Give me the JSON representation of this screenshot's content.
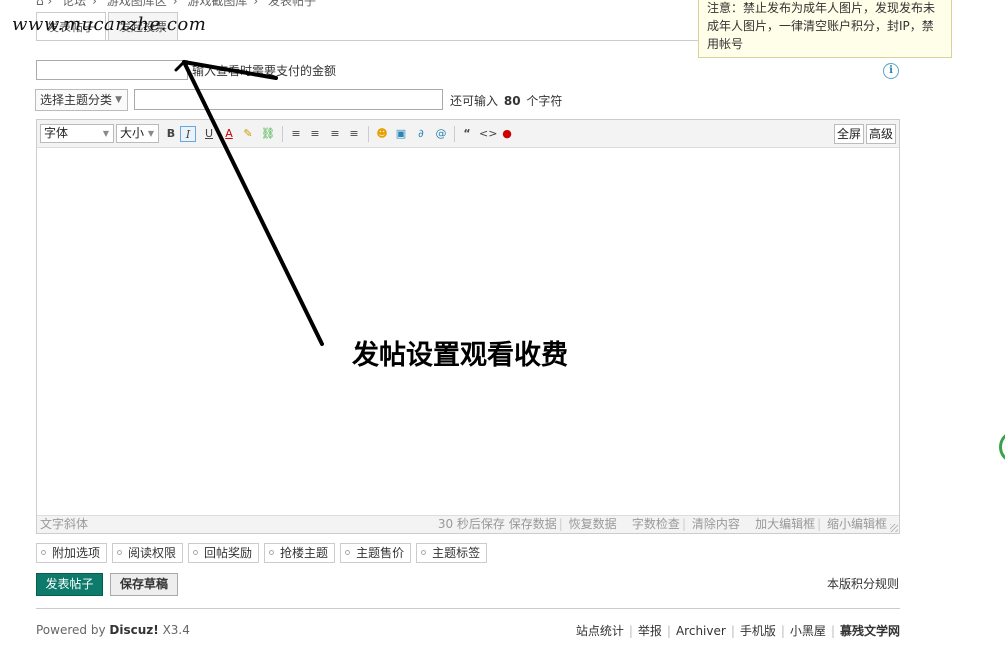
{
  "breadcrumb": [
    "论坛",
    "游戏图库区",
    "游戏截图库",
    "发表帖子"
  ],
  "tabs": [
    "发表帖子",
    "发起投票"
  ],
  "watermark": "www.mucanzhe.com",
  "notice": "注意：禁止发布为成年人图片，发现发布未成年人图片，一律清空账户积分，封IP，禁用帐号",
  "price_hint": "输入查看时需要支付的金额",
  "type_select": "选择主题分类",
  "subject_remaining": {
    "prefix": "还可输入",
    "count": "80",
    "suffix": "个字符"
  },
  "toolbar": {
    "font": "字体",
    "size": "大小",
    "fullscreen": "全屏",
    "advanced": "高级"
  },
  "status": {
    "left": "文字斜体",
    "autosave": "30 秒后保存",
    "save_data": "保存数据",
    "restore_data": "恢复数据",
    "word_check": "字数检查",
    "clear": "清除内容",
    "enlarge": "加大编辑框",
    "shrink": "缩小编辑框"
  },
  "options": [
    "附加选项",
    "阅读权限",
    "回帖奖励",
    "抢楼主题",
    "主题售价",
    "主题标签"
  ],
  "buttons": {
    "post": "发表帖子",
    "draft": "保存草稿"
  },
  "rules_link": "本版积分规则",
  "footer": {
    "powered_prefix": "Powered by",
    "powered_brand": "Discuz!",
    "powered_version": "X3.4",
    "links": [
      "站点统计",
      "举报",
      "Archiver",
      "手机版",
      "小黑屋",
      "慕残文学网"
    ]
  },
  "annotation": "发帖设置观看收费"
}
